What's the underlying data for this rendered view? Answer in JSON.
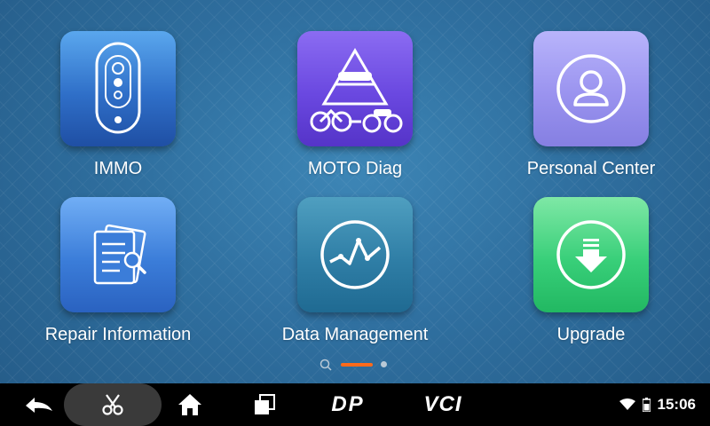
{
  "apps": [
    {
      "id": "immo",
      "label": "IMMO"
    },
    {
      "id": "moto",
      "label": "MOTO Diag"
    },
    {
      "id": "personal",
      "label": "Personal Center"
    },
    {
      "id": "repair",
      "label": "Repair Information"
    },
    {
      "id": "data",
      "label": "Data Management"
    },
    {
      "id": "upgrade",
      "label": "Upgrade"
    }
  ],
  "pager": {
    "pages": 3,
    "active_page": 2
  },
  "navbar": {
    "dp_label": "DP",
    "vci_label": "VCI"
  },
  "status": {
    "time": "15:06"
  },
  "colors": {
    "accent": "#ff6a1a",
    "navbar": "#000000",
    "background": "#2f6f9f"
  }
}
